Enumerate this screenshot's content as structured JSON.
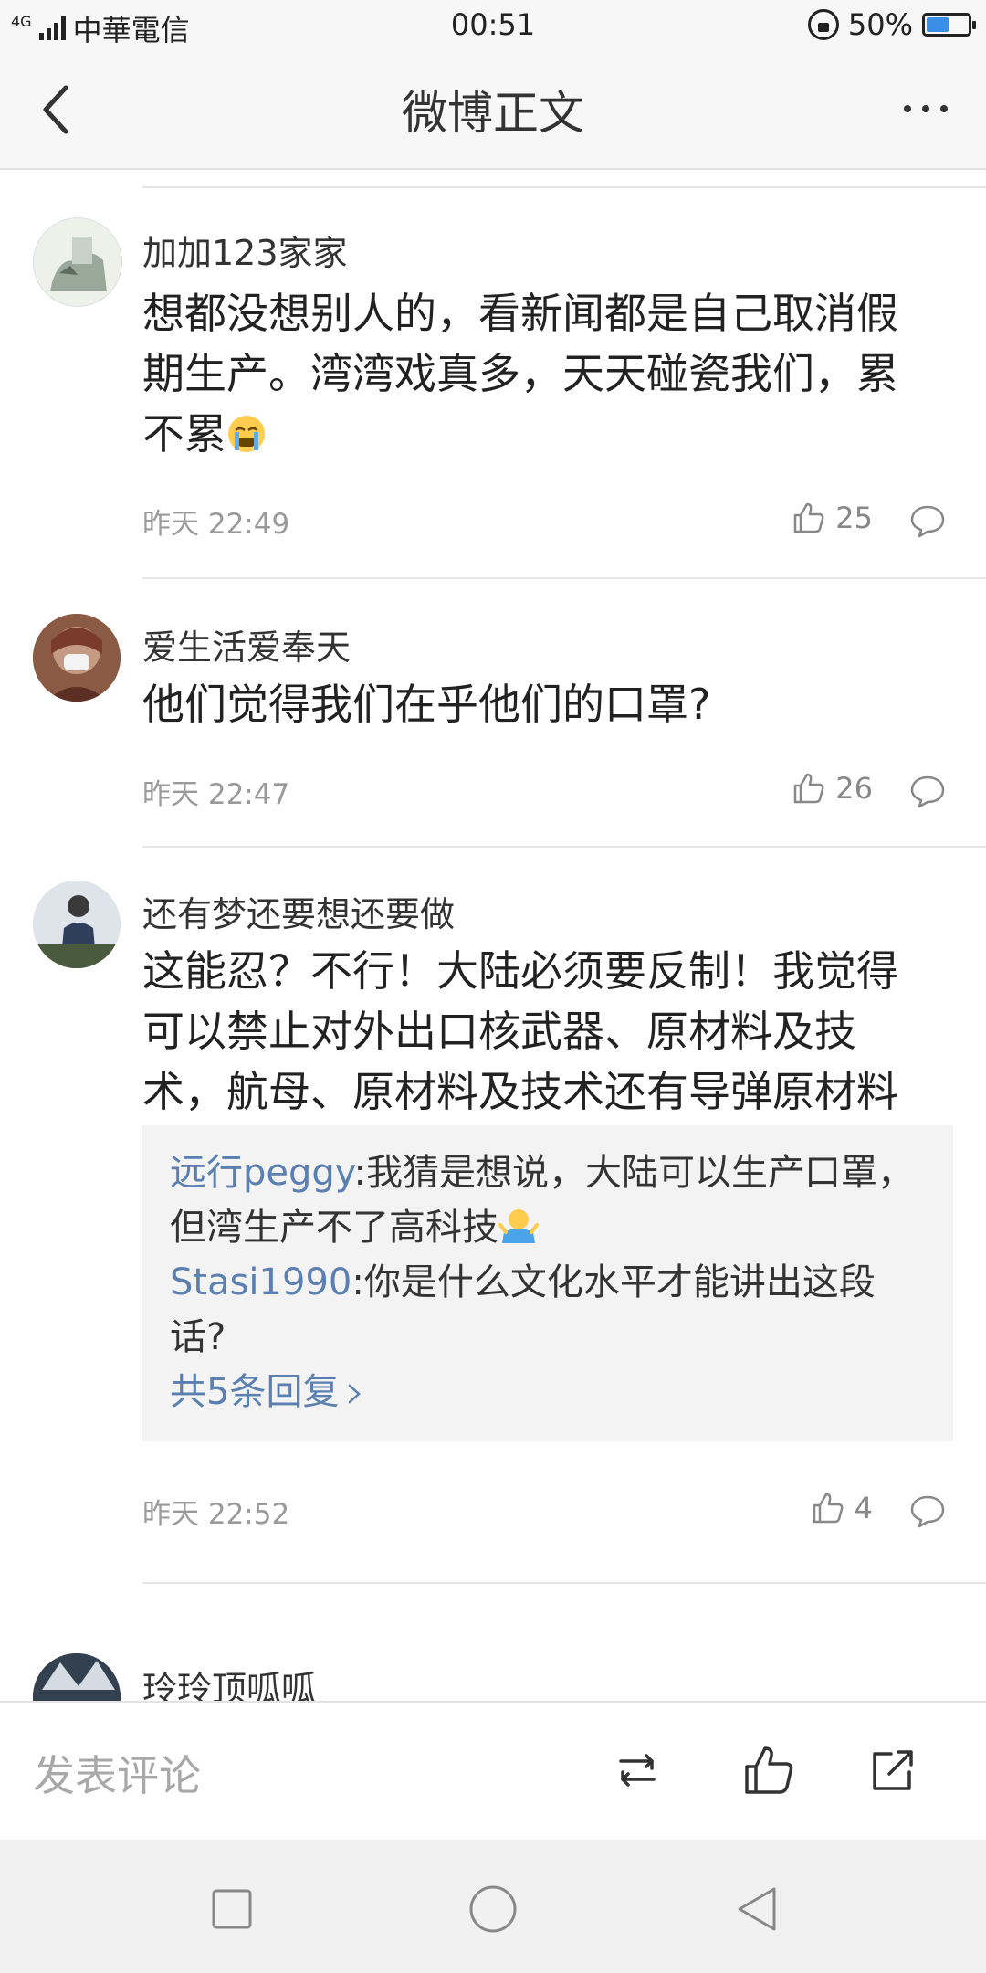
{
  "status_bar": {
    "network": "4G",
    "carrier": "中華電信",
    "time": "00:51",
    "battery_text": "50%",
    "battery_level": 0.5,
    "battery_color": "#3a8ee6"
  },
  "nav": {
    "back_icon": "chevron-left-icon",
    "title": "微博正文",
    "more_icon": "more-horizontal-icon"
  },
  "comments": [
    {
      "user": "加加123家家",
      "text": "想都没想别人的，看新闻都是自己取消假期生产。湾湾戏真多，天天碰瓷我们，累不累",
      "emoji": "crying-face-emoji",
      "time": "昨天 22:49",
      "likes": "25"
    },
    {
      "user": "爱生活爱奉天",
      "text": "他们觉得我们在乎他们的口罩?",
      "time": "昨天 22:47",
      "likes": "26"
    },
    {
      "user": "还有梦还要想还要做",
      "text": "这能忍？不行！大陆必须要反制！我觉得可以禁止对外出口核武器、原材料及技术，航母、原材料及技术还有导弹原材料及技术！",
      "replies": [
        {
          "user": "远行peggy",
          "text": ":我猜是想说，大陆可以生产口罩，但湾生产不了高科技",
          "emoji": "shrug-emoji"
        },
        {
          "user": "Stasi1990",
          "text": ":你是什么文化水平才能讲出这段话?"
        }
      ],
      "replies_more": "共5条回复",
      "time": "昨天 22:52",
      "likes": "4"
    },
    {
      "user": "玲玲顶呱呱"
    }
  ],
  "action_bar": {
    "comment_placeholder": "发表评论",
    "repost_icon": "repost-icon",
    "like_icon": "thumbs-up-icon",
    "share_icon": "share-icon"
  },
  "system_nav": {
    "recent_icon": "square-icon",
    "home_icon": "circle-icon",
    "back_icon": "triangle-back-icon"
  }
}
